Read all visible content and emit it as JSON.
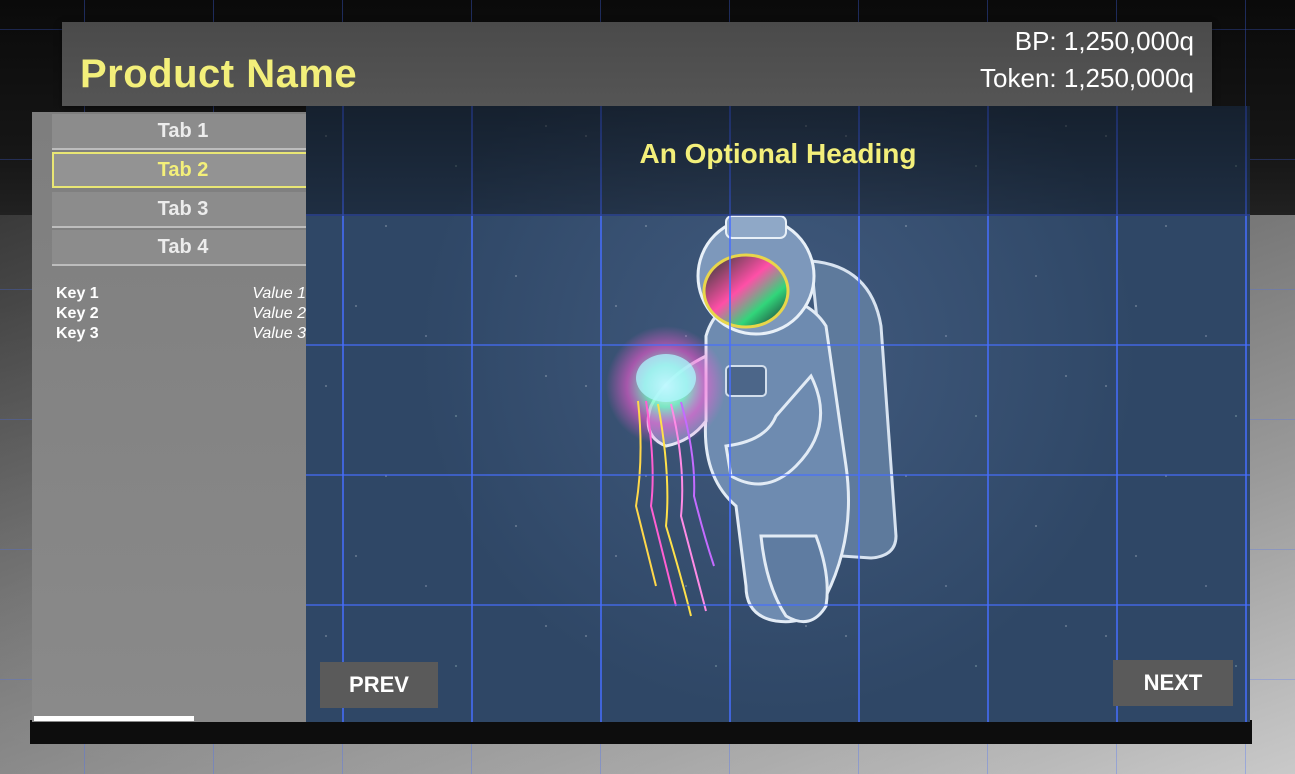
{
  "header": {
    "product_name": "Product Name",
    "bp": "BP: 1,250,000q",
    "token": "Token: 1,250,000q"
  },
  "sidebar": {
    "tabs": [
      {
        "label": "Tab 1",
        "active": false
      },
      {
        "label": "Tab 2",
        "active": true
      },
      {
        "label": "Tab 3",
        "active": false
      },
      {
        "label": "Tab 4",
        "active": false
      }
    ],
    "details": [
      {
        "key": "Key 1",
        "value": "Value 1"
      },
      {
        "key": "Key 2",
        "value": "Value 2"
      },
      {
        "key": "Key 3",
        "value": "Value 3"
      }
    ]
  },
  "content": {
    "heading": "An Optional Heading",
    "image": "astronaut-holding-jellyfish-illustration",
    "prev_label": "PREV",
    "next_label": "NEXT"
  },
  "colors": {
    "accent": "#f3ef7a",
    "panel": "#555555",
    "sidebar": "#858585",
    "button": "#5a5a5a",
    "grid": "#466eff"
  }
}
